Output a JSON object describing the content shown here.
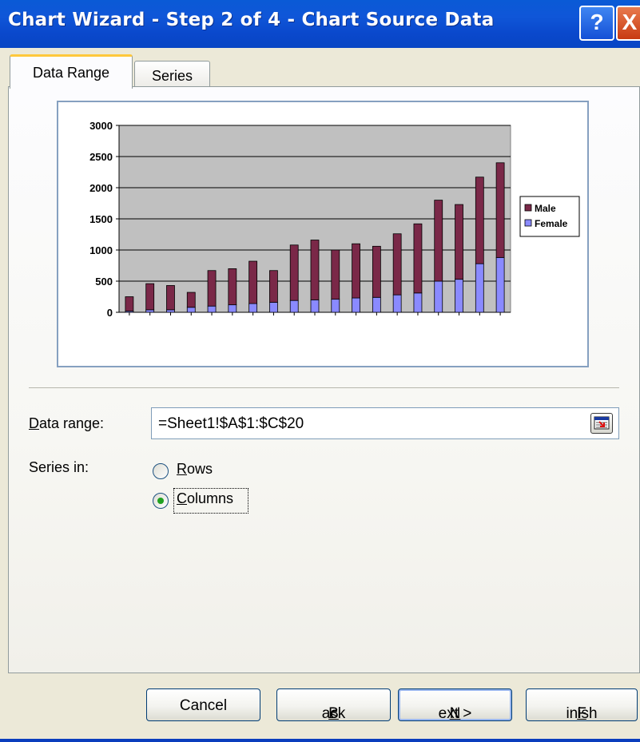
{
  "window": {
    "title": "Chart Wizard - Step 2 of 4 - Chart Source Data",
    "help_glyph": "?",
    "close_glyph": "X"
  },
  "tabs": [
    {
      "label": "Data Range",
      "active": true
    },
    {
      "label": "Series",
      "active": false
    }
  ],
  "form": {
    "data_range_label": "Data range:",
    "data_range_accel": "D",
    "data_range_rest": "ata range:",
    "data_range_value": "=Sheet1!$A$1:$C$20",
    "series_in_label": "Series in:",
    "rows_accel": "R",
    "rows_rest": "ows",
    "columns_accel": "C",
    "columns_rest": "olumns",
    "selected": "Columns"
  },
  "buttons": {
    "cancel": "Cancel",
    "back_prefix": "< ",
    "back_accel": "B",
    "back_rest": "ack",
    "next_accel": "N",
    "next_rest": "ext >",
    "finish_accel": "F",
    "finish_rest": "inish"
  },
  "colors": {
    "male": "#7a2848",
    "female": "#8a8aff",
    "plot_area": "#c0c0c0",
    "title_bar": "#0a5ad6"
  },
  "chart_data": {
    "type": "bar",
    "stacked": true,
    "ylim": [
      0,
      3000
    ],
    "yticks": [
      "3000",
      "2500",
      "2000",
      "1500",
      "1000",
      "500",
      "0"
    ],
    "grid": true,
    "legend_position": "right",
    "series": [
      {
        "name": "Male",
        "color": "#7a2848",
        "values": [
          230,
          420,
          390,
          240,
          570,
          580,
          680,
          510,
          890,
          960,
          790,
          870,
          820,
          980,
          1110,
          1300,
          1200,
          1390,
          1520
        ]
      },
      {
        "name": "Female",
        "color": "#8a8aff",
        "values": [
          20,
          40,
          40,
          80,
          100,
          120,
          140,
          160,
          190,
          200,
          210,
          230,
          240,
          280,
          310,
          500,
          530,
          780,
          880
        ]
      }
    ]
  }
}
